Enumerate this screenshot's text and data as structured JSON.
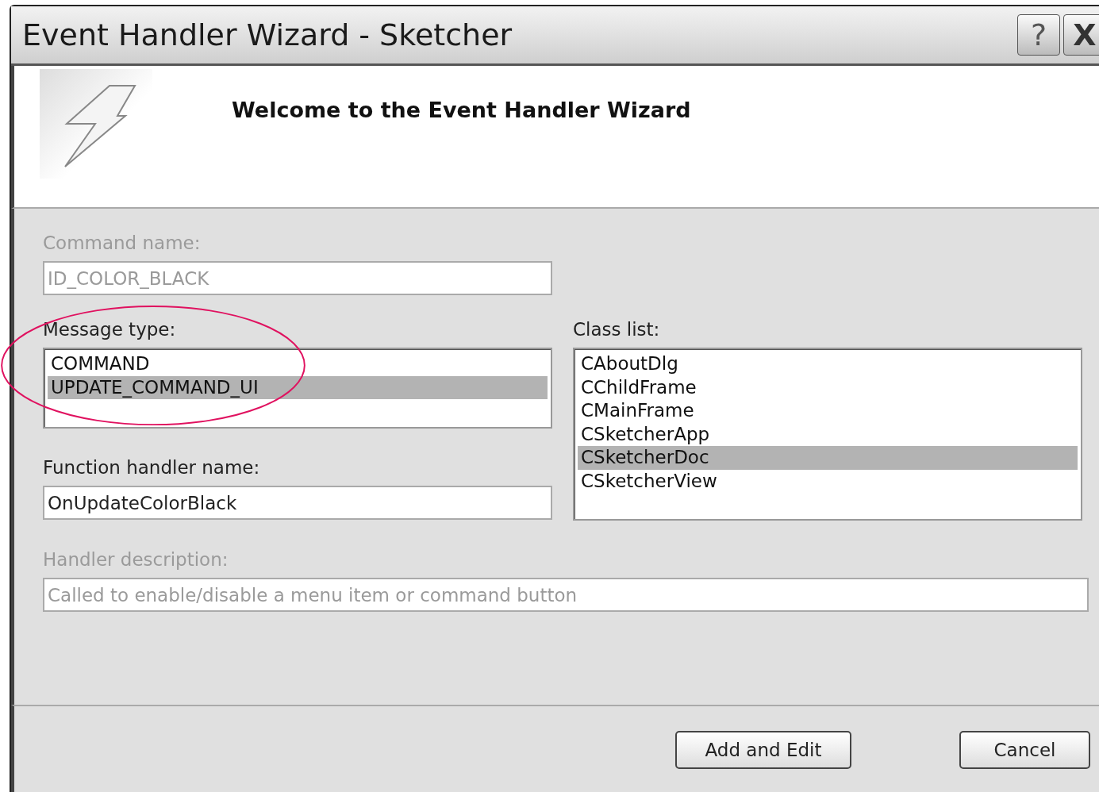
{
  "window": {
    "title": "Event Handler Wizard - Sketcher",
    "buttons": [
      {
        "kind": "help",
        "label": "?"
      },
      {
        "kind": "close",
        "label": "X"
      }
    ]
  },
  "header": {
    "title": "Welcome to the Event Handler Wizard"
  },
  "command_name": {
    "label": "Command name:",
    "value": "ID_COLOR_BLACK",
    "disabled": true
  },
  "message_type": {
    "label": "Message type:",
    "items": [
      {
        "text": "COMMAND",
        "selected": false
      },
      {
        "text": "UPDATE_COMMAND_UI",
        "selected": true
      }
    ]
  },
  "class_list": {
    "label": "Class list:",
    "items": [
      {
        "text": "CAboutDlg",
        "selected": false
      },
      {
        "text": "CChildFrame",
        "selected": false
      },
      {
        "text": "CMainFrame",
        "selected": false
      },
      {
        "text": "CSketcherApp",
        "selected": false
      },
      {
        "text": "CSketcherDoc",
        "selected": true
      },
      {
        "text": "CSketcherView",
        "selected": false
      }
    ]
  },
  "function_handler_name": {
    "label": "Function handler name:",
    "value": "OnUpdateColorBlack",
    "disabled": false
  },
  "handler_description": {
    "label": "Handler description:",
    "value": "Called to enable/disable a menu item or command button",
    "disabled": true
  },
  "buttons": [
    {
      "label": "Add and Edit"
    },
    {
      "label": "Cancel"
    }
  ]
}
